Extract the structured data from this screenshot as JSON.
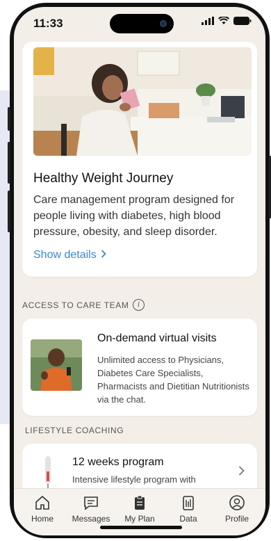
{
  "status_bar": {
    "time": "11:33"
  },
  "hero": {
    "title": "Healthy Weight Journey",
    "description": "Care management program designed for people living with diabetes, high blood pressure, obesity, and sleep disorder.",
    "link_label": "Show details",
    "link_color": "#3a86d4"
  },
  "care_team": {
    "section_label": "ACCESS TO CARE TEAM",
    "card_title": "On-demand virtual visits",
    "card_description": "Unlimited access to Physicians, Diabetes Care Specialists, Pharmacists and Dietitian Nutritionists via the chat."
  },
  "lifestyle": {
    "section_label": "LIFESTYLE COACHING",
    "card_title": "12 weeks program",
    "card_description": "Intensive lifestyle program with"
  },
  "tabs": [
    {
      "label": "Home",
      "icon": "home-icon"
    },
    {
      "label": "Messages",
      "icon": "message-icon"
    },
    {
      "label": "My Plan",
      "icon": "clipboard-icon"
    },
    {
      "label": "Data",
      "icon": "data-icon"
    },
    {
      "label": "Profile",
      "icon": "profile-icon"
    }
  ]
}
